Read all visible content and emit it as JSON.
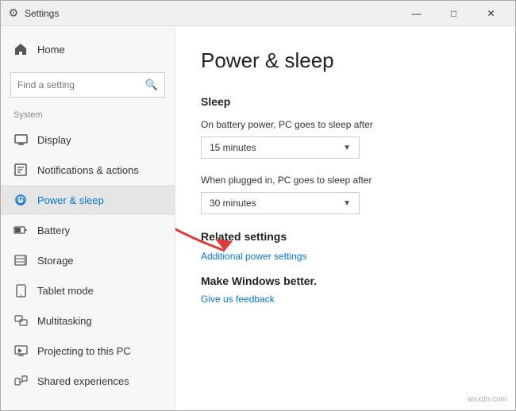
{
  "titlebar": {
    "title": "Settings",
    "icon": "⚙",
    "minimize": "—",
    "maximize": "□",
    "close": "✕"
  },
  "sidebar": {
    "search_placeholder": "Find a setting",
    "system_label": "System",
    "home_label": "Home",
    "nav_items": [
      {
        "id": "display",
        "label": "Display",
        "icon": "display"
      },
      {
        "id": "notifications",
        "label": "Notifications & actions",
        "icon": "notifications"
      },
      {
        "id": "power-sleep",
        "label": "Power & sleep",
        "icon": "power",
        "active": true
      },
      {
        "id": "battery",
        "label": "Battery",
        "icon": "battery"
      },
      {
        "id": "storage",
        "label": "Storage",
        "icon": "storage"
      },
      {
        "id": "tablet-mode",
        "label": "Tablet mode",
        "icon": "tablet"
      },
      {
        "id": "multitasking",
        "label": "Multitasking",
        "icon": "multitasking"
      },
      {
        "id": "projecting",
        "label": "Projecting to this PC",
        "icon": "projecting"
      },
      {
        "id": "shared",
        "label": "Shared experiences",
        "icon": "shared"
      }
    ]
  },
  "main": {
    "title": "Power & sleep",
    "sleep_section": "Sleep",
    "battery_label": "On battery power, PC goes to sleep after",
    "battery_value": "15 minutes",
    "plugged_label": "When plugged in, PC goes to sleep after",
    "plugged_value": "30 minutes",
    "related_heading": "Related settings",
    "additional_link": "Additional power settings",
    "make_windows_heading": "Make Windows better.",
    "feedback_link": "Give us feedback"
  },
  "watermark": "wsxdn.com"
}
